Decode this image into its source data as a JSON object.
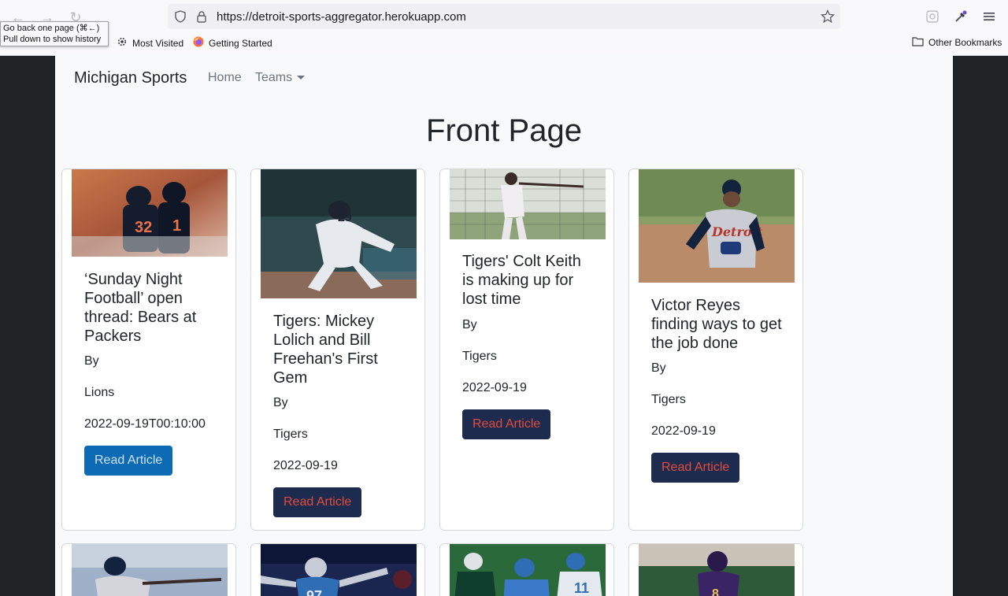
{
  "browser": {
    "url": "https://detroit-sports-aggregator.herokuapp.com",
    "tooltip_line1": "Go back one page (⌘←)",
    "tooltip_line2": "Pull down to show history",
    "bookmarks": [
      {
        "label": "Most Visited",
        "icon": "gear-icon"
      },
      {
        "label": "Getting Started",
        "icon": "firefox-icon"
      }
    ],
    "other_bookmarks": "Other Bookmarks"
  },
  "navbar": {
    "brand": "Michigan Sports",
    "home": "Home",
    "teams": "Teams"
  },
  "main": {
    "heading": "Front Page",
    "cards": [
      {
        "title": "‘Sunday Night Football’ open thread: Bears at Packers",
        "author": "By",
        "team": "Lions",
        "date": "2022-09-19T00:10:00",
        "button": "Read Article",
        "button_style": "blue"
      },
      {
        "title": "Tigers: Mickey Lolich and Bill Freehan's First Gem",
        "author": "By",
        "team": "Tigers",
        "date": "2022-09-19",
        "button": "Read Article",
        "button_style": "navy"
      },
      {
        "title": "Tigers' Colt Keith is making up for lost time",
        "author": "By",
        "team": "Tigers",
        "date": "2022-09-19",
        "button": "Read Article",
        "button_style": "navy"
      },
      {
        "title": "Victor Reyes finding ways to get the job done",
        "author": "By",
        "team": "Tigers",
        "date": "2022-09-19",
        "button": "Read Article",
        "button_style": "navy"
      }
    ]
  },
  "colors": {
    "navy_button": "#1c2b4e",
    "button_text_red": "#e34b3c",
    "blue_button": "#0d6ab4"
  }
}
